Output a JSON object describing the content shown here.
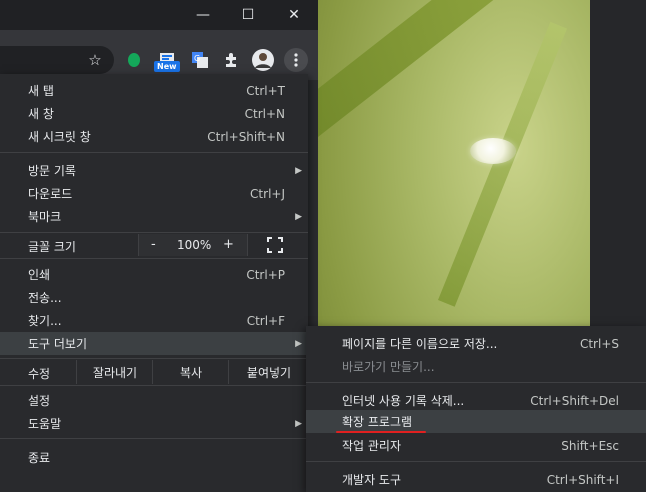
{
  "window": {
    "minimize": "—",
    "maximize": "☐",
    "close": "✕"
  },
  "toolbar": {
    "bookmark_icon": "star-icon",
    "extensions": [
      "evernote-icon",
      "new-extension-icon",
      "translate-icon",
      "puzzle-icon"
    ],
    "new_badge": "New",
    "menu_icon": "kebab-menu-icon"
  },
  "menu": {
    "items": [
      {
        "label": "새 탭",
        "shortcut": "Ctrl+T"
      },
      {
        "label": "새 창",
        "shortcut": "Ctrl+N"
      },
      {
        "label": "새 시크릿 창",
        "shortcut": "Ctrl+Shift+N"
      },
      {
        "label": "방문 기록",
        "shortcut": ""
      },
      {
        "label": "다운로드",
        "shortcut": "Ctrl+J"
      },
      {
        "label": "북마크",
        "shortcut": ""
      },
      {
        "label": "인쇄",
        "shortcut": "Ctrl+P"
      },
      {
        "label": "전송...",
        "shortcut": ""
      },
      {
        "label": "찾기...",
        "shortcut": "Ctrl+F"
      },
      {
        "label": "도구 더보기",
        "shortcut": ""
      },
      {
        "label": "설정",
        "shortcut": ""
      },
      {
        "label": "도움말",
        "shortcut": ""
      },
      {
        "label": "종료",
        "shortcut": ""
      }
    ],
    "zoom": {
      "label": "글꼴 크기",
      "minus": "-",
      "value": "100%",
      "plus": "+"
    },
    "edit": {
      "label": "수정",
      "cut": "잘라내기",
      "copy": "복사",
      "paste": "붙여넣기"
    }
  },
  "submenu": {
    "items": [
      {
        "label": "페이지를 다른 이름으로 저장...",
        "shortcut": "Ctrl+S"
      },
      {
        "label": "바로가기 만들기...",
        "shortcut": ""
      },
      {
        "label": "인터넷 사용 기록 삭제...",
        "shortcut": "Ctrl+Shift+Del"
      },
      {
        "label": "확장 프로그램",
        "shortcut": ""
      },
      {
        "label": "작업 관리자",
        "shortcut": "Shift+Esc"
      },
      {
        "label": "개발자 도구",
        "shortcut": "Ctrl+Shift+I"
      }
    ]
  }
}
